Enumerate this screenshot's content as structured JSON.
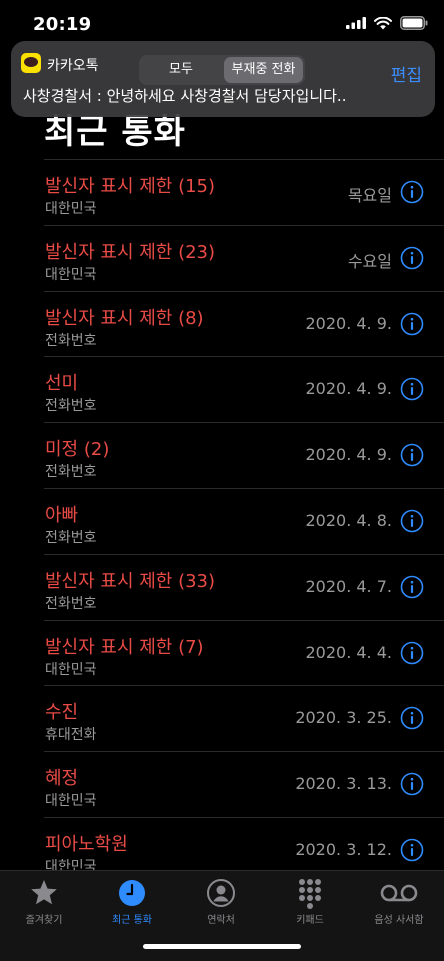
{
  "status": {
    "time": "20:19"
  },
  "notification": {
    "app_name": "카카오톡",
    "message": "사창경찰서 : 안녕하세요 사창경찰서 담당자입니다.."
  },
  "header": {
    "segments": [
      "모두",
      "부재중 전화"
    ],
    "edit_label": "편집",
    "title": "최근 통화"
  },
  "calls": [
    {
      "name": "발신자 표시 제한 (15)",
      "sub": "대한민국",
      "date": "목요일"
    },
    {
      "name": "발신자 표시 제한 (23)",
      "sub": "대한민국",
      "date": "수요일"
    },
    {
      "name": "발신자 표시 제한 (8)",
      "sub": "전화번호",
      "date": "2020. 4. 9."
    },
    {
      "name": "선미",
      "sub": "전화번호",
      "date": "2020. 4. 9."
    },
    {
      "name": "미정 (2)",
      "sub": "전화번호",
      "date": "2020. 4. 9."
    },
    {
      "name": "아빠",
      "sub": "전화번호",
      "date": "2020. 4. 8."
    },
    {
      "name": "발신자 표시 제한 (33)",
      "sub": "전화번호",
      "date": "2020. 4. 7."
    },
    {
      "name": "발신자 표시 제한 (7)",
      "sub": "대한민국",
      "date": "2020. 4. 4."
    },
    {
      "name": "수진",
      "sub": "휴대전화",
      "date": "2020. 3. 25."
    },
    {
      "name": "혜정",
      "sub": "대한민국",
      "date": "2020. 3. 13."
    },
    {
      "name": "피아노학원",
      "sub": "대한민국",
      "date": "2020. 3. 12."
    }
  ],
  "tabs": [
    {
      "label": "즐겨찾기",
      "icon": "star-icon",
      "active": false
    },
    {
      "label": "최근 통화",
      "icon": "clock-icon",
      "active": true
    },
    {
      "label": "연락처",
      "icon": "person-icon",
      "active": false
    },
    {
      "label": "키패드",
      "icon": "keypad-icon",
      "active": false
    },
    {
      "label": "음성 사서함",
      "icon": "voicemail-icon",
      "active": false
    }
  ],
  "colors": {
    "missed_call": "#e94b46",
    "accent": "#2f8cff",
    "kakao_yellow": "#fae100"
  }
}
